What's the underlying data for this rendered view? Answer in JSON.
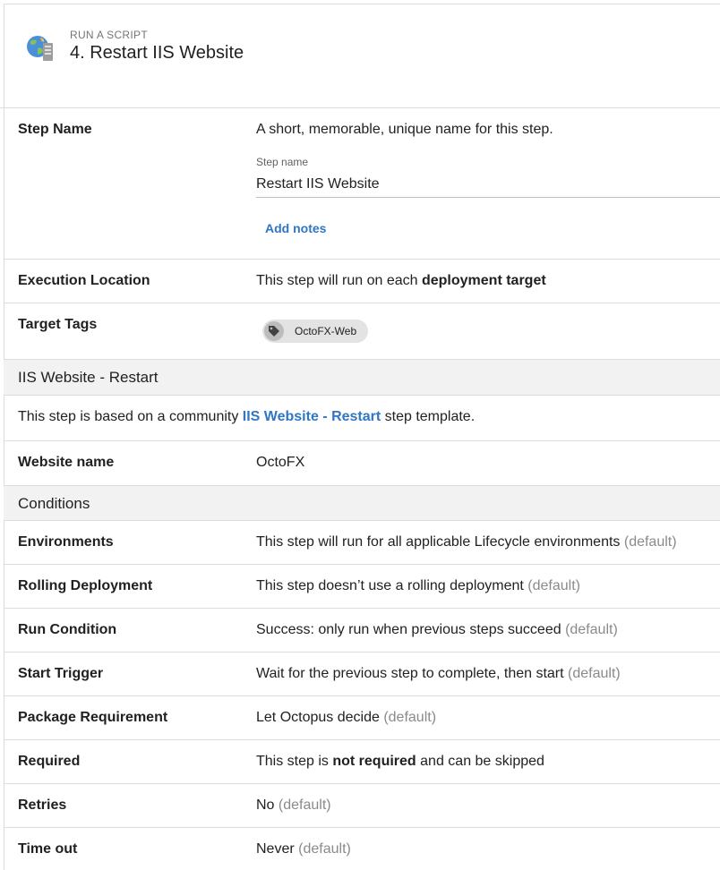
{
  "header": {
    "kicker": "RUN A SCRIPT",
    "title": "4. Restart IIS Website"
  },
  "step_name": {
    "label": "Step Name",
    "description": "A short, memorable, unique name for this step.",
    "field_label": "Step name",
    "field_value": "Restart IIS Website",
    "add_notes": "Add notes"
  },
  "execution_location": {
    "label": "Execution Location",
    "text_prefix": "This step will run on each ",
    "text_bold": "deployment target"
  },
  "target_tags": {
    "label": "Target Tags",
    "tag": "OctoFX-Web"
  },
  "iis_section": {
    "title": "IIS Website - Restart",
    "based_prefix": "This step is based on a community ",
    "based_link": "IIS Website - Restart",
    "based_suffix": " step template."
  },
  "website_name": {
    "label": "Website name",
    "value": "OctoFX"
  },
  "conditions": {
    "title": "Conditions",
    "default_text": "(default)",
    "rows": [
      {
        "label": "Environments",
        "value": "This step will run for all applicable Lifecycle environments"
      },
      {
        "label": "Rolling Deployment",
        "value": "This step doesn’t use a rolling deployment"
      },
      {
        "label": "Run Condition",
        "value": "Success: only run when previous steps succeed"
      },
      {
        "label": "Start Trigger",
        "value": "Wait for the previous step to complete, then start"
      },
      {
        "label": "Package Requirement",
        "value": "Let Octopus decide"
      }
    ],
    "required": {
      "label": "Required",
      "prefix": "This step is ",
      "bold": "not required",
      "suffix": " and can be skipped"
    },
    "retries": {
      "label": "Retries",
      "value": "No"
    },
    "timeout": {
      "label": "Time out",
      "value": "Never"
    }
  }
}
